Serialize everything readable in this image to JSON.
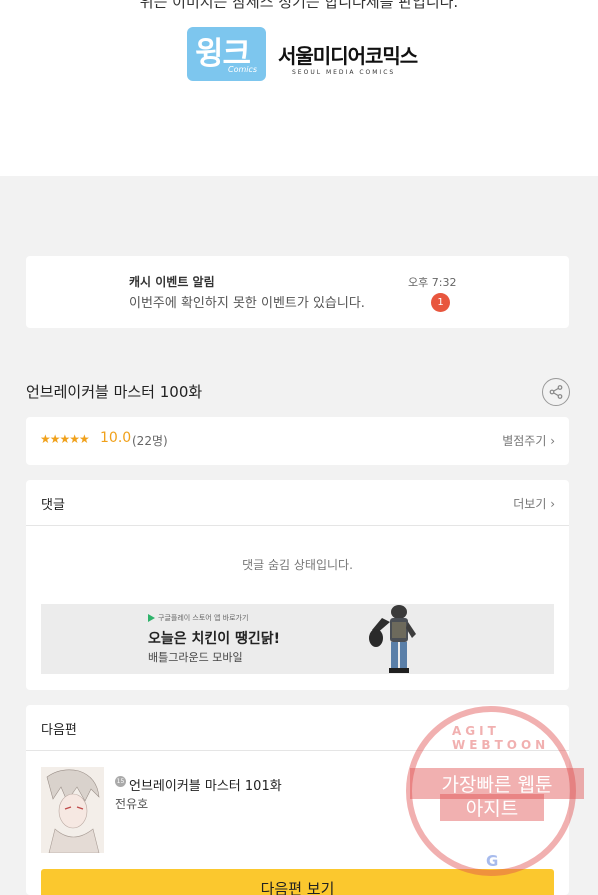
{
  "header": {
    "cut_text": "위는 이미지는 참세스 정기는 합니다제를 판입니다.",
    "logo_wink_text": "윙크",
    "logo_wink_sub": "Comics",
    "logo_publisher": "서울미디어코믹스",
    "logo_publisher_en": "SEOUL MEDIA COMICS"
  },
  "notification": {
    "title": "캐시 이벤트 알림",
    "message": "이번주에 확인하지 못한 이벤트가 있습니다.",
    "time": "오후 7:32",
    "badge": "1"
  },
  "episode": {
    "title": "언브레이커블 마스터 100화"
  },
  "rating": {
    "stars": "★★★★★",
    "score": "10.0",
    "count": "(22명)",
    "rate_label": "별점주기 ›"
  },
  "comments": {
    "heading": "댓글",
    "more_label": "더보기 ›",
    "hidden_message": "댓글 숨김 상태입니다.",
    "ad": {
      "small_text": "구글플레이 스토어 앱 바로가기",
      "headline": "오늘은 치킨이 땡긴닭!",
      "sub": "배틀그라운드 모바일"
    }
  },
  "next": {
    "heading": "다음편",
    "age_badge": "15",
    "episode_name": "언브레이커블 마스터 101화",
    "author": "전유호",
    "button_label": "다음편 보기"
  },
  "watermark": {
    "ring": "AGIT WEBTOON",
    "line1": "가장빠른 웹툰",
    "line2": "아지트",
    "g": "G"
  },
  "colors": {
    "accent_star": "#f0a11b",
    "badge_red": "#e8563e",
    "next_button": "#fbc82e"
  }
}
